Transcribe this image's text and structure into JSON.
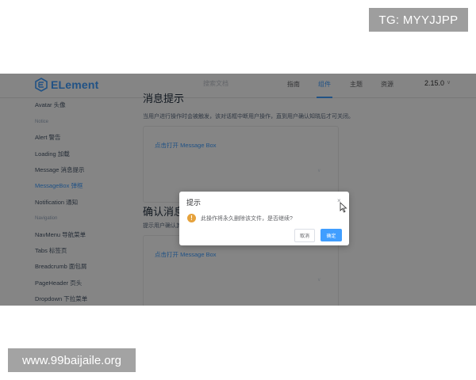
{
  "watermarks": {
    "top": "TG: MYYJJPP",
    "bottom": "www.99baijaile.org"
  },
  "header": {
    "logo_text": "ELement",
    "search_placeholder": "搜索文档",
    "nav": [
      "指南",
      "组件",
      "主题",
      "资源"
    ],
    "active_nav": "组件",
    "version": "2.15.0",
    "version_caret": "∨"
  },
  "sidebar": {
    "items": [
      {
        "label": "Avatar 头像"
      },
      {
        "group": "Notice"
      },
      {
        "label": "Alert 警告"
      },
      {
        "label": "Loading 加载"
      },
      {
        "label": "Message 消息提示"
      },
      {
        "label": "MessageBox 弹框",
        "active": true
      },
      {
        "label": "Notification 通知"
      },
      {
        "group": "Navigation"
      },
      {
        "label": "NavMenu 导航菜单"
      },
      {
        "label": "Tabs 标签页"
      },
      {
        "label": "Breadcrumb 面包屑"
      },
      {
        "label": "PageHeader 页头"
      },
      {
        "label": "Dropdown 下拉菜单"
      }
    ]
  },
  "content": {
    "section1_title": "消息提示",
    "section1_desc": "当用户进行操作时会被触发，该对话框中断用户操作，直到用户确认知晓后才可关闭。",
    "section1_link": "点击打开 Message Box",
    "section2_title": "确认消息",
    "section2_desc": "提示用户确认其已经触发的动作，并询问是否进行此操作时会用到此方法。",
    "section2_link": "点击打开 Message Box",
    "toggle_glyph": "∨"
  },
  "dialog": {
    "title": "提示",
    "close_glyph": "×",
    "warning_glyph": "!",
    "message": "此操作将永久删除该文件，是否继续?",
    "cancel_label": "取消",
    "confirm_label": "确定"
  },
  "colors": {
    "brand": "#409eff",
    "warning": "#e6a23c",
    "mask": "rgba(0,0,0,0.48)"
  }
}
